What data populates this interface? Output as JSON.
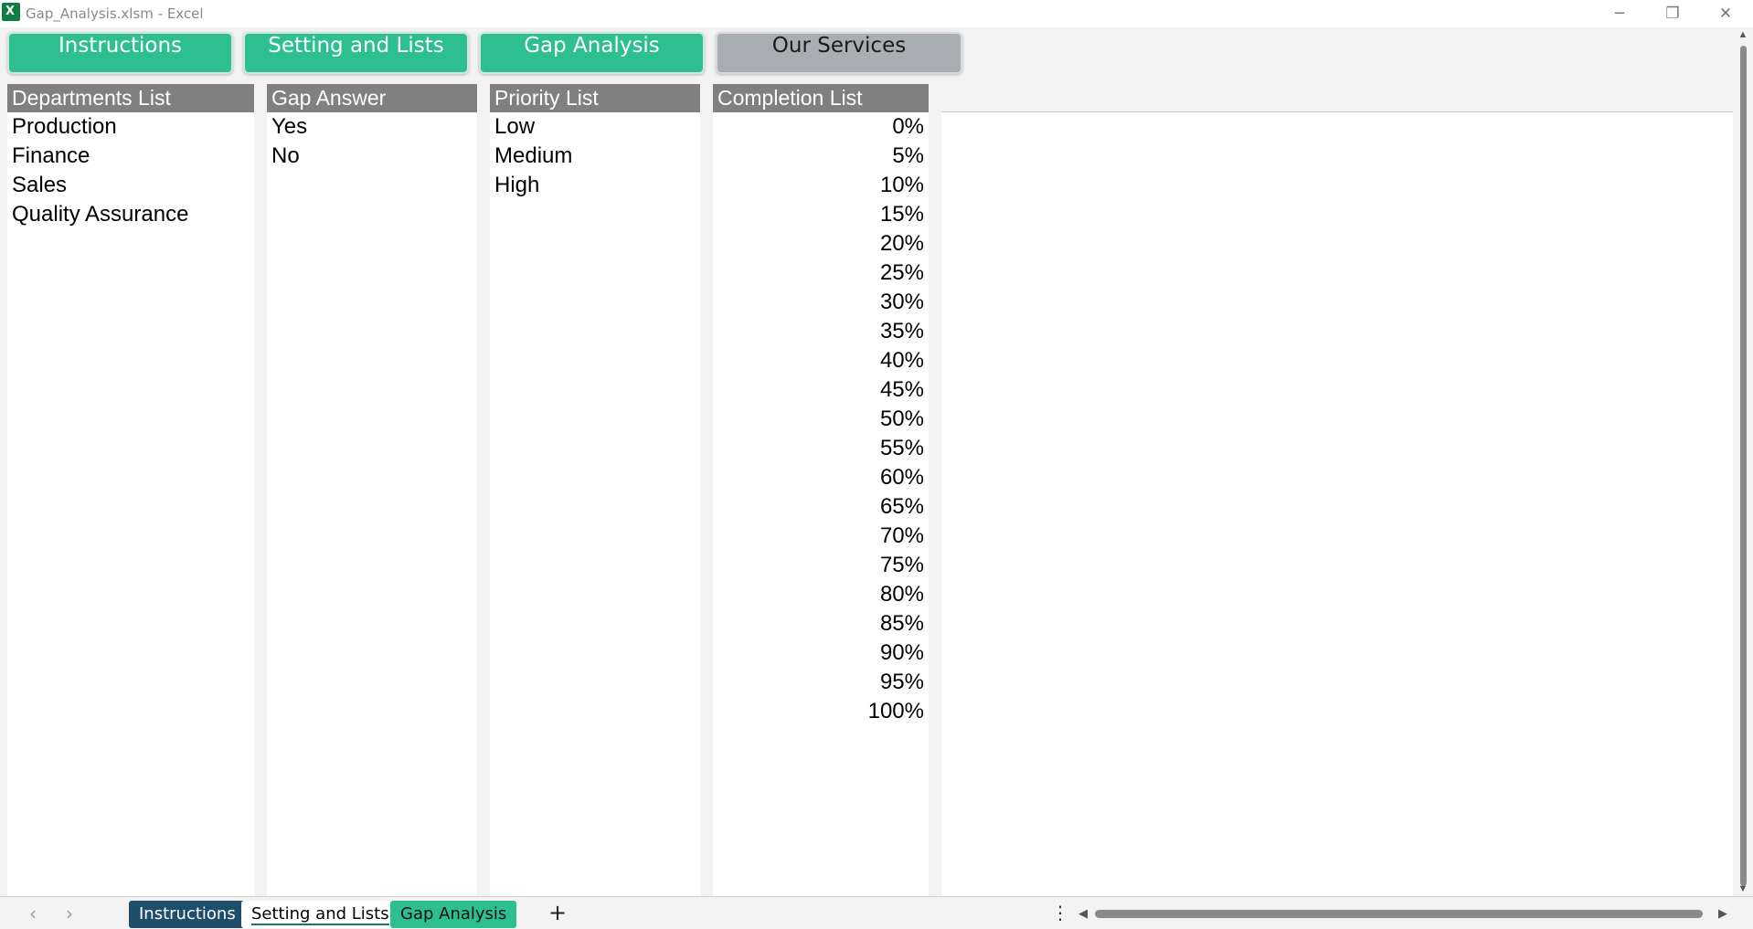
{
  "window": {
    "title": "Gap_Analysis.xlsm - Excel",
    "minimize_glyph": "─",
    "restore_glyph": "❐",
    "close_glyph": "✕"
  },
  "macro_buttons": [
    {
      "label": "Instructions",
      "color": "#2ebf91"
    },
    {
      "label": "Setting and Lists",
      "color": "#2ebf91"
    },
    {
      "label": "Gap Analysis",
      "color": "#2ebf91"
    },
    {
      "label": "Our Services",
      "color": "#a9aeb3"
    }
  ],
  "lists": {
    "departments": {
      "header": "Departments List",
      "items": [
        "Production",
        "Finance",
        "Sales",
        "Quality Assurance"
      ]
    },
    "gap_answer": {
      "header": "Gap Answer",
      "items": [
        "Yes",
        "No"
      ]
    },
    "priority": {
      "header": "Priority List",
      "items": [
        "Low",
        "Medium",
        "High"
      ]
    },
    "completion": {
      "header": "Completion List",
      "items": [
        "0%",
        "5%",
        "10%",
        "15%",
        "20%",
        "25%",
        "30%",
        "35%",
        "40%",
        "45%",
        "50%",
        "55%",
        "60%",
        "65%",
        "70%",
        "75%",
        "80%",
        "85%",
        "90%",
        "95%",
        "100%"
      ]
    }
  },
  "sheet_tabs": {
    "prev_glyph": "‹",
    "next_glyph": "›",
    "tabs": [
      {
        "label": "Instructions",
        "state": "dark"
      },
      {
        "label": "Setting and Lists",
        "state": "active"
      },
      {
        "label": "Gap Analysis",
        "state": "green"
      }
    ],
    "add_glyph": "+",
    "more_glyph": "⋮"
  },
  "scrollbars": {
    "up_glyph": "▲",
    "down_glyph": "▼",
    "left_glyph": "◀",
    "right_glyph": "▶"
  },
  "colors": {
    "header_gray": "#808080",
    "accent_green": "#2ebf91",
    "tab_dark": "#1f4e6b"
  }
}
